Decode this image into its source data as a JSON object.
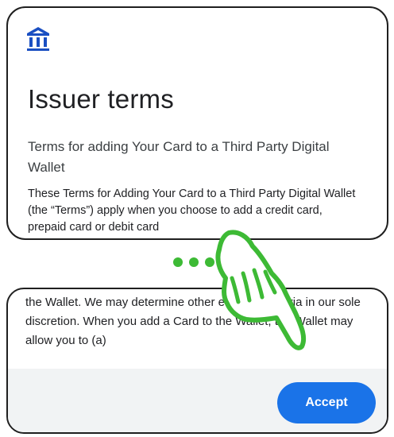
{
  "dialog": {
    "icon": "bank-icon",
    "title": "Issuer terms",
    "subtitle": "Terms for adding Your Card to a Third Party Digital Wallet",
    "body_top": "These Terms for Adding Your Card to a Third Party Digital Wallet (the “Terms”) apply when you choose to add a credit card, prepaid card or debit card",
    "body_bottom": "the Wallet. We may determine other eligibility criteria in our sole discretion. When you add a Card to the Wallet, the Wallet may allow you to (a)",
    "accept_label": "Accept"
  },
  "overlay": {
    "continuation_indicator": "ellipsis-dots",
    "gesture": "scroll-hand-icon"
  },
  "colors": {
    "accent_blue": "#1a73e8",
    "bank_icon_blue": "#1a4fc2",
    "gesture_green": "#3dba35",
    "footer_gray": "#f1f3f4",
    "border": "#1f1f1f"
  }
}
